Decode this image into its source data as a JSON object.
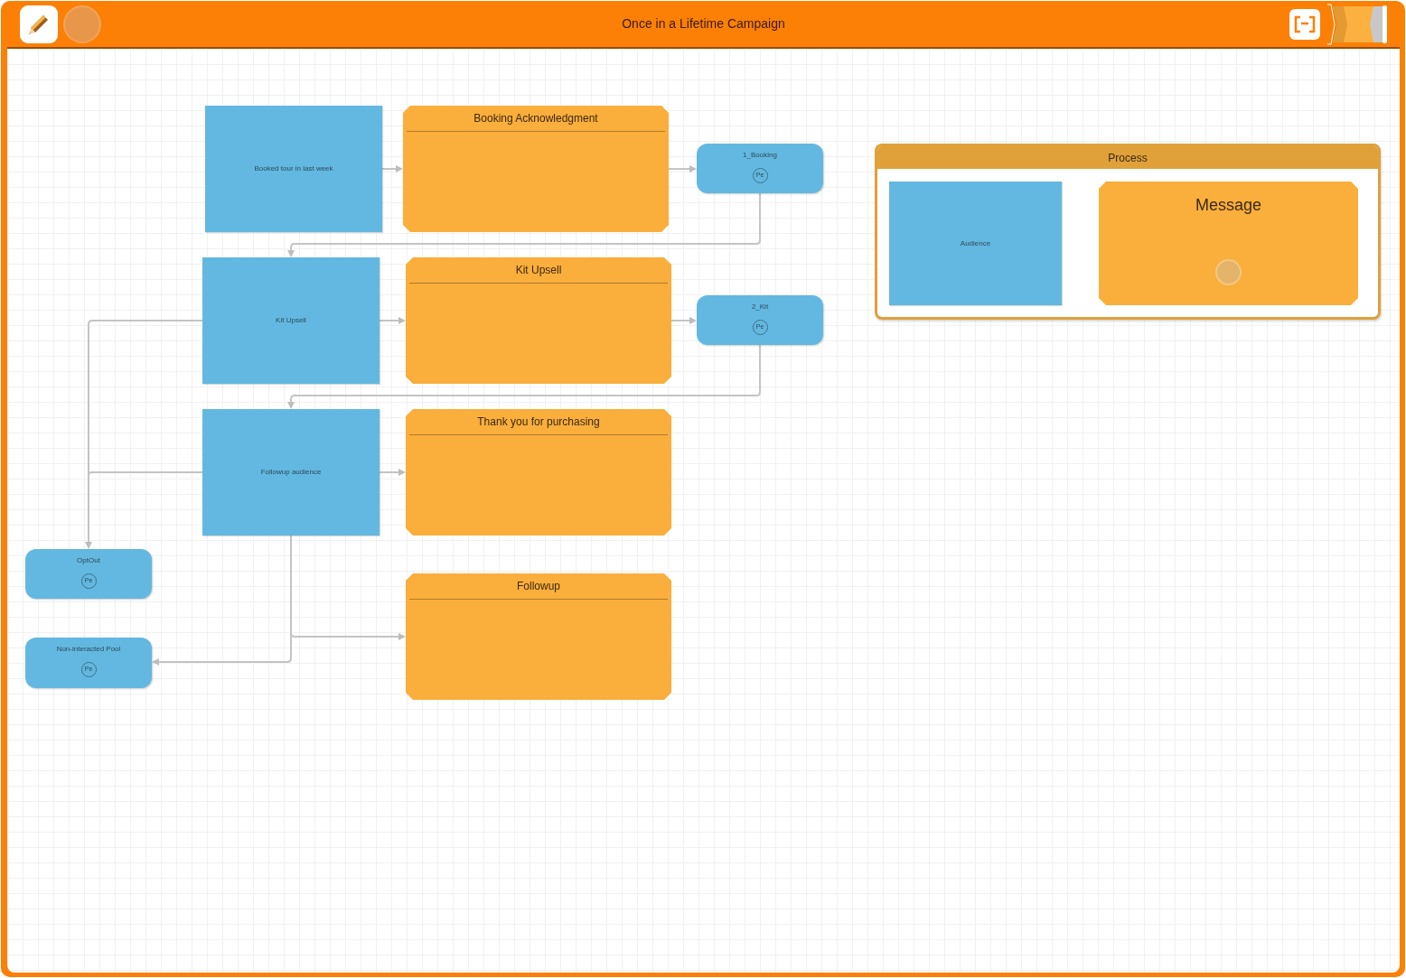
{
  "window": {
    "title": "Once in a Lifetime Campaign"
  },
  "canvas": {
    "nodes": [
      {
        "kind": "audience",
        "label": "Booked tour in last week"
      },
      {
        "kind": "message",
        "label": "Booking Acknowledgment"
      },
      {
        "kind": "pool",
        "label": "1_Booking",
        "badge": "Pe"
      },
      {
        "kind": "audience",
        "label": "Kit Upsell"
      },
      {
        "kind": "message",
        "label": "Kit Upsell"
      },
      {
        "kind": "pool",
        "label": "2_Kit",
        "badge": "Pe"
      },
      {
        "kind": "audience",
        "label": "Followup audience"
      },
      {
        "kind": "message",
        "label": "Thank you for purchasing"
      },
      {
        "kind": "pool",
        "label": "OptOut",
        "badge": "Pe"
      },
      {
        "kind": "message",
        "label": "Followup"
      },
      {
        "kind": "pool",
        "label": "Non-interacted Pool",
        "badge": "Pe"
      }
    ]
  },
  "process_panel": {
    "title": "Process",
    "nodes": [
      {
        "kind": "audience",
        "label": "Audience"
      },
      {
        "kind": "template",
        "label": "Message"
      }
    ]
  }
}
